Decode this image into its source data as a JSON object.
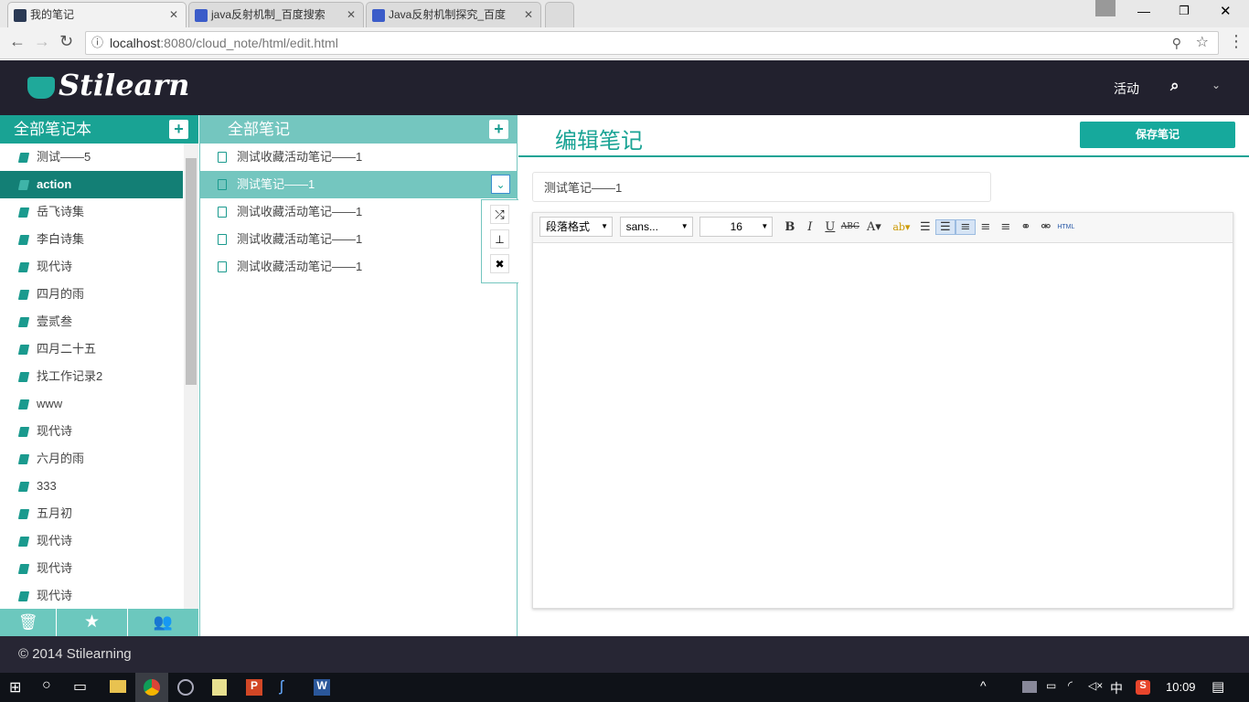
{
  "browser": {
    "tabs": [
      {
        "title": "我的笔记",
        "active": true
      },
      {
        "title": "java反射机制_百度搜索",
        "active": false
      },
      {
        "title": "Java反射机制探究_百度",
        "active": false
      }
    ],
    "url_host": "localhost",
    "url_rest": ":8080/cloud_note/html/edit.html"
  },
  "header": {
    "logo": "Stilearn",
    "activity": "活动"
  },
  "notebooks": {
    "title": "全部笔记本",
    "add": "+",
    "items": [
      "测试——5",
      "action",
      "岳飞诗集",
      "李白诗集",
      "现代诗",
      "四月的雨",
      "壹贰叁",
      "四月二十五",
      "找工作记录2",
      "www",
      "现代诗",
      "六月的雨",
      "333",
      "五月初",
      "现代诗",
      "现代诗",
      "现代诗"
    ],
    "selected": 1
  },
  "notes": {
    "title": "全部笔记",
    "add": "+",
    "items": [
      "测试收藏活动笔记——1",
      "测试笔记——1",
      "测试收藏活动笔记——1",
      "测试收藏活动笔记——1",
      "测试收藏活动笔记——1"
    ],
    "selected": 1
  },
  "editor": {
    "title": "编辑笔记",
    "save": "保存笔记",
    "note_title": "测试笔记——1",
    "format": "段落格式",
    "font": "sans...",
    "size": "16",
    "html": "HTML"
  },
  "footer": {
    "copyright": "© 2014 Stilearning"
  },
  "taskbar": {
    "ime": "中",
    "time": "10:09"
  },
  "colors": {
    "teal": "#19a394",
    "teal_light": "#74c6bf",
    "dark": "#22212e",
    "selected": "#137f75"
  }
}
